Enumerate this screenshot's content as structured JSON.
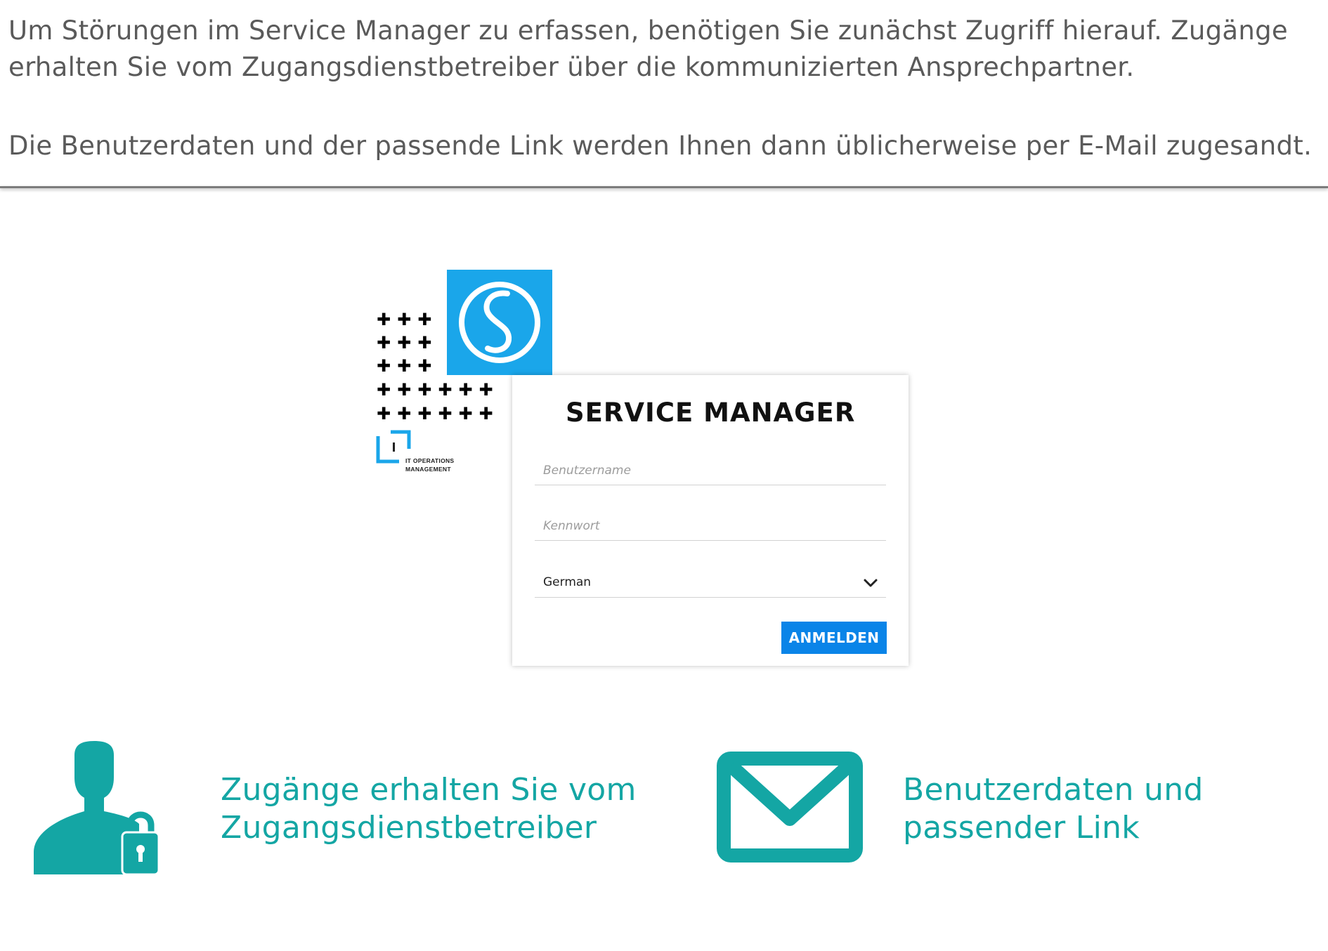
{
  "intro": {
    "paragraph1": "Um Störungen im Service Manager zu erfassen, benötigen Sie zunächst Zugriff hierauf. Zugänge erhalten Sie vom Zugangsdienstbetreiber über die kommunizierten Ansprechpartner.",
    "paragraph2": "Die Benutzerdaten und der passende Link werden Ihnen dann üblicherweise per E-Mail zugesandt."
  },
  "login": {
    "title": "SERVICE MANAGER",
    "username_placeholder": "Benutzername",
    "password_placeholder": "Kennwort",
    "language_value": "German",
    "submit_label": "ANMELDEN"
  },
  "branding": {
    "itom_line1": "IT OPERATIONS",
    "itom_line2": "MANAGEMENT",
    "logo_color": "#1aa6ea",
    "itom_color": "#1aa6ea"
  },
  "features": {
    "access_line1": "Zugänge erhalten Sie vom",
    "access_line2": "Zugangsdienstbetreiber",
    "credentials_line1": "Benutzerdaten und",
    "credentials_line2": "passender Link",
    "accent_color": "#14a6a4"
  },
  "icons": {
    "access": "user-lock-icon",
    "mail": "envelope-icon",
    "chevron": "chevron-down-icon",
    "logo": "s-logo-icon"
  },
  "colors": {
    "text": "#5a5a5a",
    "button": "#0a84e8"
  }
}
